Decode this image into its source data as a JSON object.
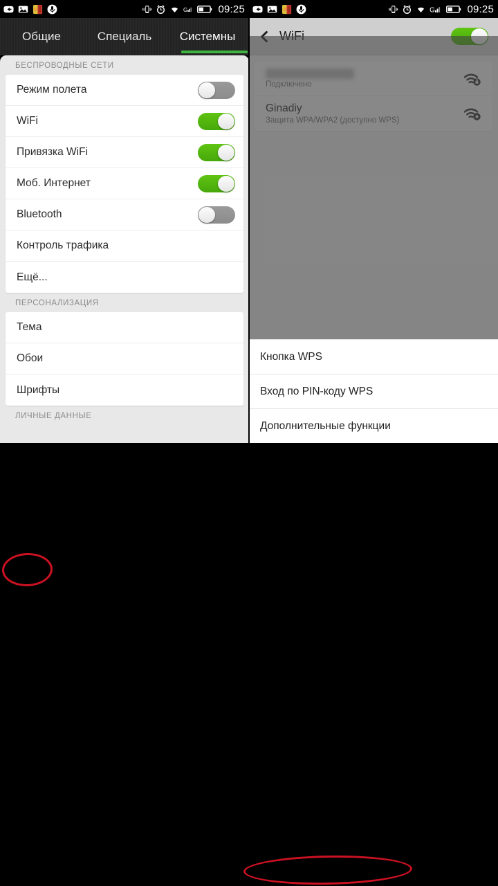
{
  "status_bar": {
    "time": "09:25",
    "left_icons": [
      "back-arrow-notification-icon",
      "photo-notification-icon",
      "app-notification-icon",
      "microphone-notification-icon"
    ],
    "right_icons": [
      "vibrate-icon",
      "alarm-icon",
      "wifi-icon",
      "cellular-signal-g-icon",
      "battery-icon"
    ]
  },
  "left_screen": {
    "tabs": [
      {
        "label": "Общие",
        "active": false
      },
      {
        "label": "Специаль",
        "active": false
      },
      {
        "label": "Системны",
        "active": true
      }
    ],
    "sections": [
      {
        "title": "БЕСПРОВОДНЫЕ СЕТИ",
        "rows": [
          {
            "label": "Режим полета",
            "toggle": "off"
          },
          {
            "label": "WiFi",
            "toggle": "on"
          },
          {
            "label": "Привязка WiFi",
            "toggle": "on"
          },
          {
            "label": "Моб. Интернет",
            "toggle": "on"
          },
          {
            "label": "Bluetooth",
            "toggle": "off"
          },
          {
            "label": "Контроль трафика",
            "toggle": "none"
          },
          {
            "label": "Ещё...",
            "toggle": "none"
          }
        ]
      },
      {
        "title": "ПЕРСОНАЛИЗАЦИЯ",
        "rows": [
          {
            "label": "Тема",
            "toggle": "none"
          },
          {
            "label": "Обои",
            "toggle": "none"
          },
          {
            "label": "Шрифты",
            "toggle": "none"
          }
        ]
      },
      {
        "title": "ЛИЧНЫЕ ДАННЫЕ",
        "rows": []
      }
    ]
  },
  "right_screen": {
    "header": {
      "title": "WiFi",
      "back_icon": "chevron-left-icon",
      "toggle": "on"
    },
    "networks": [
      {
        "name": "",
        "name_hidden": true,
        "status": "Подключено",
        "icon": "wifi-secured-icon"
      },
      {
        "name": "Ginadiy",
        "name_hidden": false,
        "status": "Защита WPA/WPA2 (доступно WPS)",
        "icon": "wifi-secured-icon"
      }
    ],
    "bottom_menu": [
      {
        "label": "Кнопка WPS"
      },
      {
        "label": "Вход по PIN-коду WPS"
      },
      {
        "label": "Дополнительные функции"
      }
    ]
  },
  "annotations": {
    "accent_color": "#cc1122",
    "highlights": [
      "WiFi",
      "Дополнительные функции"
    ]
  },
  "colors": {
    "toggle_on": "#4eb30c",
    "toggle_off": "#939393",
    "tab_indicator": "#3fb53f",
    "status_bar": "#000000"
  }
}
